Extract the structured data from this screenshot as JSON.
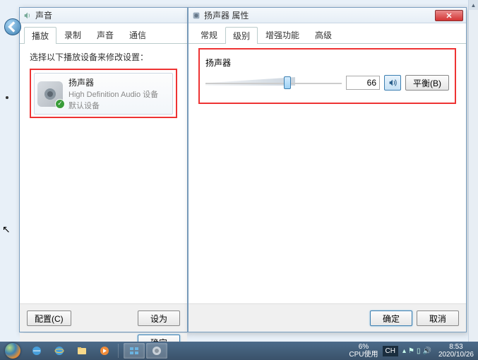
{
  "sound_window": {
    "title": "声音",
    "tabs": [
      "播放",
      "录制",
      "声音",
      "通信"
    ],
    "active_tab": 0,
    "instruction": "选择以下播放设备来修改设置：",
    "device": {
      "name": "扬声器",
      "subtitle": "High Definition Audio 设备",
      "status": "默认设备"
    },
    "configure_btn": "配置(C)",
    "set_default_btn": "设为",
    "ok_btn": "确定"
  },
  "props_window": {
    "title": "扬声器 属性",
    "tabs": [
      "常规",
      "级别",
      "增强功能",
      "高级"
    ],
    "active_tab": 1,
    "level": {
      "label": "扬声器",
      "value": "66",
      "balance_btn": "平衡(B)"
    },
    "ok_btn": "确定",
    "cancel_btn": "取消"
  },
  "taskbar": {
    "cpu_percent": "6%",
    "cpu_label": "CPU使用",
    "lang": "CH",
    "time": "8:53",
    "date": "2020/10/26"
  }
}
